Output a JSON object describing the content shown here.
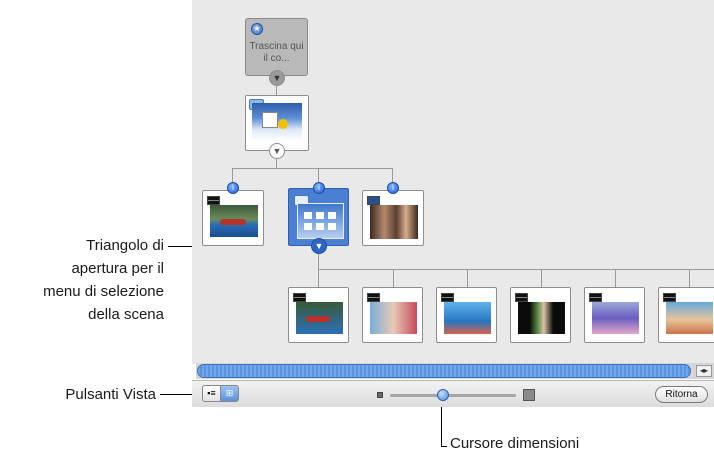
{
  "callouts": {
    "triangle": [
      "Triangolo di",
      "apertura per il",
      "menu di selezione",
      "della scena"
    ],
    "view_buttons": "Pulsanti Vista",
    "size_slider": "Cursore dimensioni"
  },
  "map": {
    "drop_zone_text": [
      "Trascina qui",
      "il co..."
    ]
  },
  "toolbar": {
    "return_label": "Ritorna"
  },
  "icons": {
    "badge": "info-badge-icon",
    "disclosure": "disclosure-triangle-icon",
    "clapper": "movie-clapper-icon",
    "folder": "submenu-folder-icon"
  }
}
